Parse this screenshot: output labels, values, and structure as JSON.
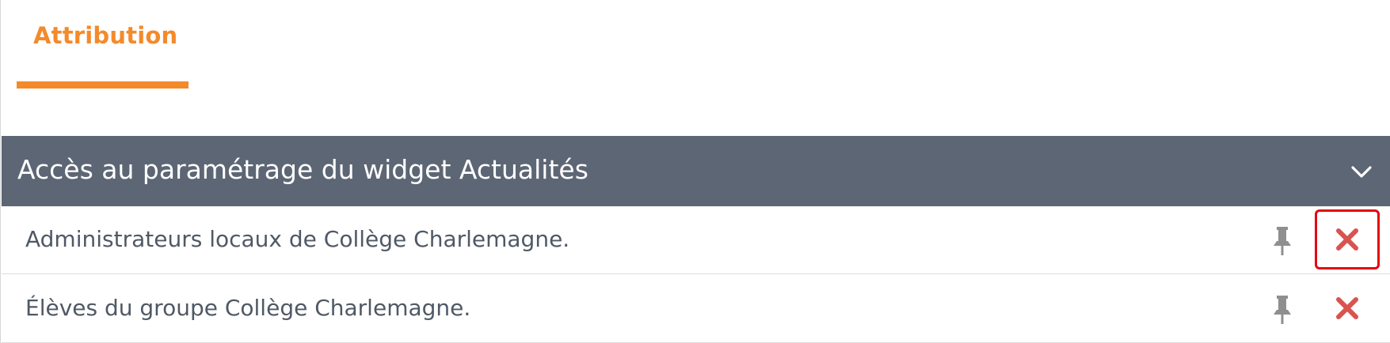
{
  "tabs": {
    "active_label": "Attribution"
  },
  "section": {
    "title": "Accès au paramétrage du widget Actualités",
    "collapse_icon": "chevron-down-icon"
  },
  "rows": [
    {
      "label": "Administrateurs locaux de Collège Charlemagne."
    },
    {
      "label": "Élèves du groupe Collège Charlemagne."
    }
  ],
  "icons": {
    "pin": "pin-icon",
    "delete": "close-icon"
  },
  "colors": {
    "accent": "#f48a2b",
    "header_bg": "#5d6674",
    "delete": "#d9534f",
    "pin": "#8f8f8f",
    "highlight": "#e30613"
  }
}
